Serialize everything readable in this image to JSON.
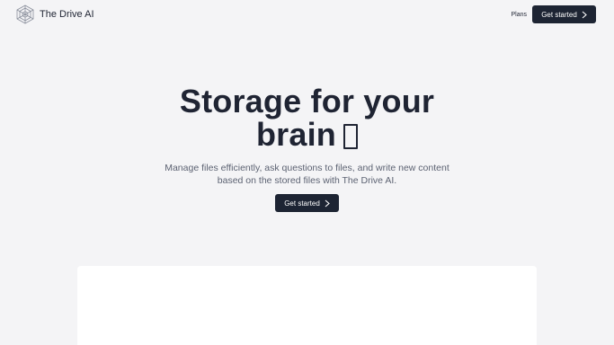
{
  "header": {
    "brand_name": "The Drive AI",
    "brand_icon": "hexagon-cube-logo-icon",
    "plans_label": "Plans",
    "cta_label": "Get started"
  },
  "hero": {
    "title_line1": "Storage for your",
    "title_line2": "brain",
    "subtitle": "Manage files efficiently, ask questions to files, and write new content based on the stored files with The Drive AI.",
    "cta_label": "Get started"
  },
  "colors": {
    "background": "#f4f4f6",
    "button_dark": "#1d2433",
    "text_primary": "#1f2433",
    "text_secondary": "#5c6272",
    "panel": "#ffffff"
  }
}
